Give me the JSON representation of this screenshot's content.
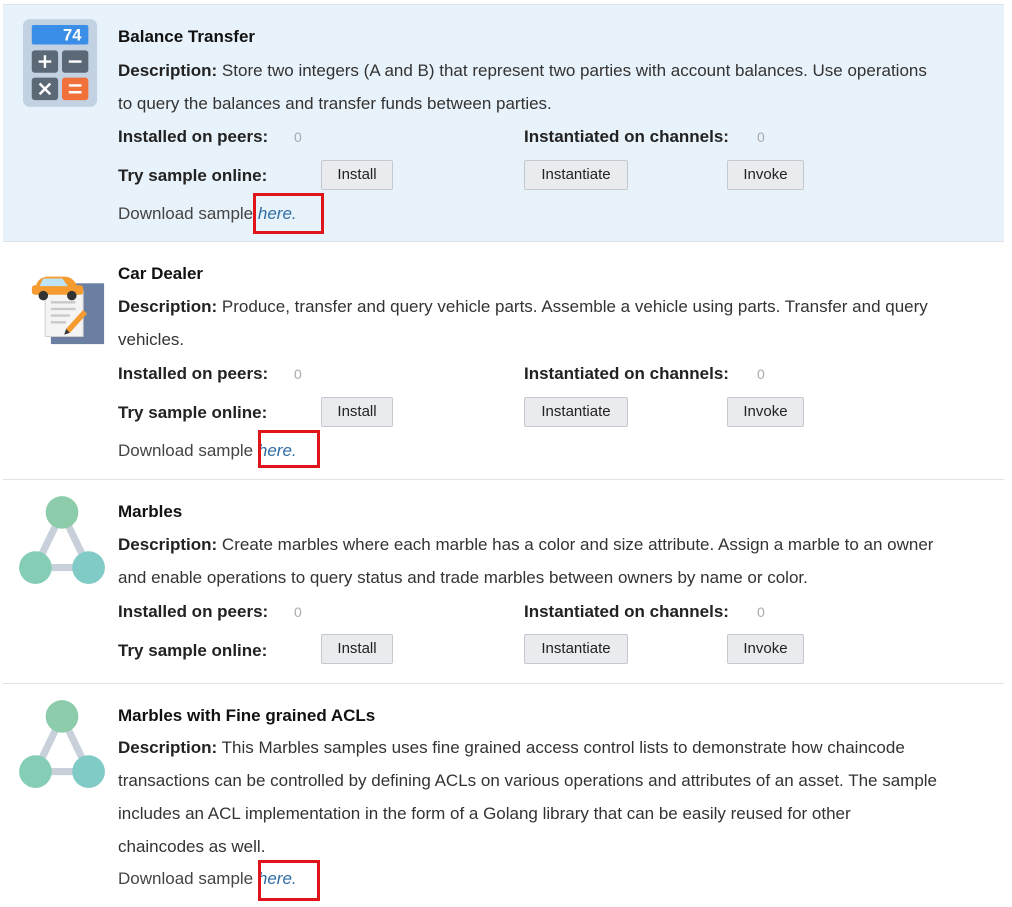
{
  "labels": {
    "description": "Description:",
    "installed_on_peers": "Installed on peers:",
    "instantiated_on_channels": "Instantiated on channels:",
    "try_sample_online": "Try sample online:",
    "install": "Install",
    "instantiate": "Instantiate",
    "invoke": "Invoke",
    "download_prefix": "Download sample",
    "download_link": "here."
  },
  "samples": [
    {
      "title": "Balance Transfer",
      "description": "Store two integers (A and B) that represent two parties with account balances. Use operations to query the balances and transfer funds between parties.",
      "installed_peers": "0",
      "instantiated_channels": "0",
      "icon": "calculator-icon",
      "calculator_display": "74"
    },
    {
      "title": "Car Dealer",
      "description": "Produce, transfer and query vehicle parts. Assemble a vehicle using parts. Transfer and query vehicles.",
      "installed_peers": "0",
      "instantiated_channels": "0",
      "icon": "car-document-icon"
    },
    {
      "title": "Marbles",
      "description": "Create marbles where each marble has a color and size attribute. Assign a marble to an owner and enable operations to query status and trade marbles between owners by name or color.",
      "installed_peers": "0",
      "instantiated_channels": "0",
      "icon": "network-triangle-icon"
    },
    {
      "title": "Marbles with Fine grained ACLs",
      "description": "This Marbles samples uses fine grained access control lists to demonstrate how chaincode transactions can be controlled by defining ACLs on various operations and attributes of an asset. The sample includes an ACL implementation in the form of a Golang library that can be easily reused for other chaincodes as well.",
      "icon": "network-triangle-icon"
    }
  ],
  "colors": {
    "highlight_bg": "#e8f2fa",
    "link": "#2e6da4",
    "annotation_box": "#e0151b"
  }
}
